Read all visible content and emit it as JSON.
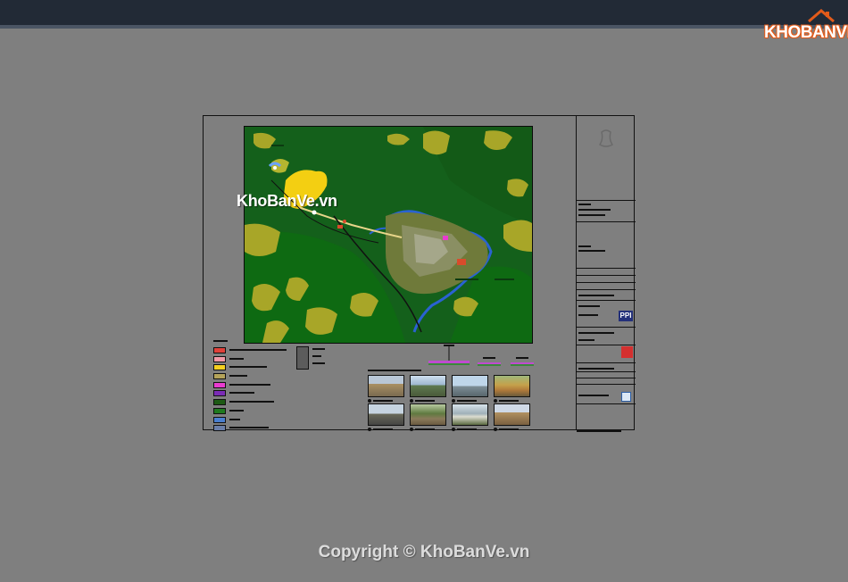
{
  "brand": {
    "logo_text": "KHOBANVE",
    "watermark": "KhoBanVe.vn",
    "copyright": "Copyright © KhoBanVe.vn"
  },
  "sheet": {
    "titleblock_badge": "PPI"
  },
  "legend_colors": [
    "#e0413a",
    "#f29aa8",
    "#f5d020",
    "#b4a35a",
    "#e93bd0",
    "#7a2bb5",
    "#1d5a14",
    "#1f7a1f",
    "#4a7fd0",
    "#6a7ea8"
  ],
  "colors": {
    "page_bg": "#7f7f7f",
    "topbar": "#222a36",
    "map_base": "#0f5a1a",
    "logo_accent": "#e35b1a"
  }
}
